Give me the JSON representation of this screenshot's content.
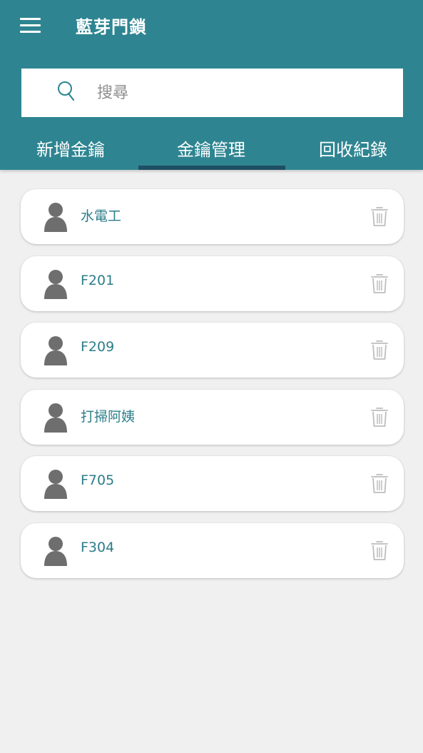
{
  "header": {
    "title": "藍芽門鎖",
    "menu_icon": "hamburger-menu-icon"
  },
  "search": {
    "placeholder": "搜尋",
    "value": "",
    "icon": "search-icon"
  },
  "tabs": [
    {
      "label": "新增金鑰",
      "active": false
    },
    {
      "label": "金鑰管理",
      "active": true
    },
    {
      "label": "回收紀錄",
      "active": false
    }
  ],
  "keys": [
    {
      "name": "水電工"
    },
    {
      "name": "F201"
    },
    {
      "name": "F209"
    },
    {
      "name": "打掃阿姨"
    },
    {
      "name": "F705"
    },
    {
      "name": "F304"
    }
  ],
  "colors": {
    "primary": "#2e8591",
    "tab_indicator": "#1e4e63",
    "background": "#f0f0f0",
    "name_text": "#2b7d89",
    "avatar": "#6e6e6e",
    "trash": "#bdbdbd"
  }
}
